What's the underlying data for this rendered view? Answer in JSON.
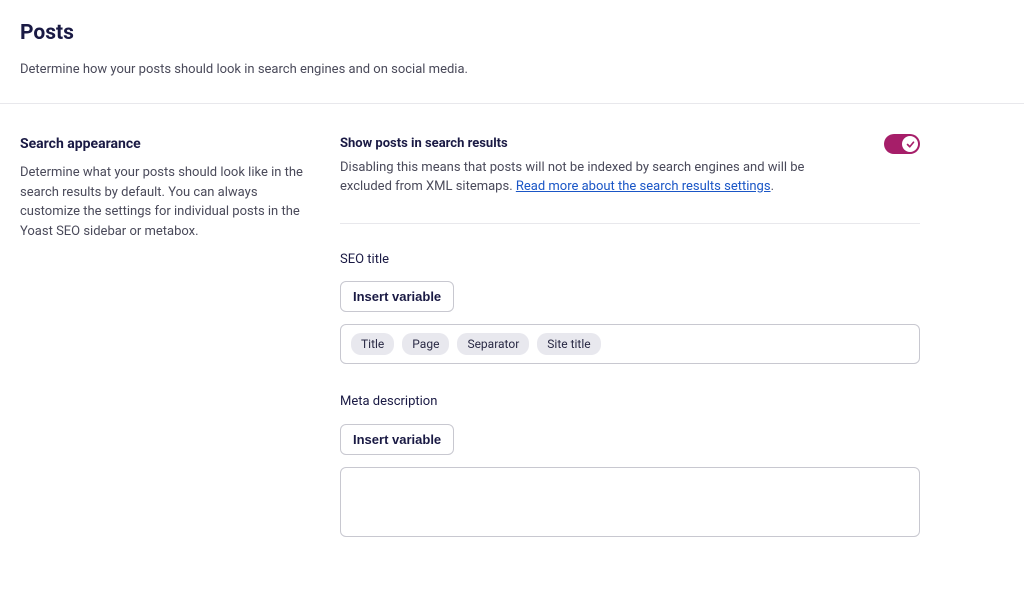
{
  "page": {
    "title": "Posts",
    "subtitle": "Determine how your posts should look in search engines and on social media."
  },
  "search_appearance": {
    "heading": "Search appearance",
    "description": "Determine what your posts should look like in the search results by default. You can always customize the settings for individual posts in the Yoast SEO sidebar or metabox."
  },
  "show_posts": {
    "label": "Show posts in search results",
    "description": "Disabling this means that posts will not be indexed by search engines and will be excluded from XML sitemaps. ",
    "link_text": "Read more about the search results settings",
    "period": ".",
    "enabled": true
  },
  "seo_title": {
    "label": "SEO title",
    "insert_button": "Insert variable",
    "pills": [
      "Title",
      "Page",
      "Separator",
      "Site title"
    ]
  },
  "meta_description": {
    "label": "Meta description",
    "insert_button": "Insert variable",
    "pills": []
  },
  "colors": {
    "toggle_on": "#a61e69",
    "link": "#1a56c6"
  }
}
